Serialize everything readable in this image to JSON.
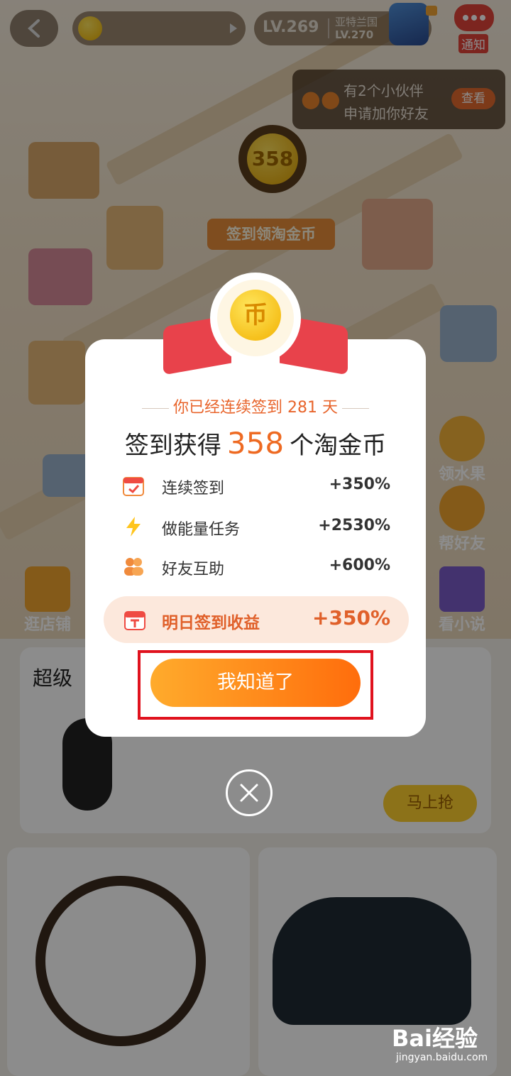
{
  "topbar": {
    "level_current": "LV.269",
    "next_place": "亚特兰国",
    "level_next": "LV.270",
    "notify_label": "通知"
  },
  "friend_tip": {
    "line1": "有2个小伙伴",
    "line2": "申请加你好友",
    "view_label": "查看"
  },
  "map": {
    "coin_value": "358",
    "sign_banner": "签到领淘金币",
    "side_buttons": [
      "领水果",
      "帮好友",
      "逛店铺",
      "看小说"
    ]
  },
  "background_cards": {
    "section_title": "超级",
    "grab_button": "马上抢"
  },
  "modal": {
    "medal_glyph": "币",
    "streak_text": "你已经连续签到 281 天",
    "gain_prefix": "签到获得",
    "gain_number": "358",
    "gain_suffix": "个淘金币",
    "rows": [
      {
        "icon": "calendar-check-icon",
        "label": "连续签到",
        "value": "+350%"
      },
      {
        "icon": "lightning-icon",
        "label": "做能量任务",
        "value": "+2530%"
      },
      {
        "icon": "friends-icon",
        "label": "好友互助",
        "value": "+600%"
      }
    ],
    "tomorrow": {
      "icon": "calendar-t-icon",
      "label": "明日签到收益",
      "value": "+350%"
    },
    "ok_button": "我知道了",
    "close_icon": "close-icon"
  },
  "watermark": {
    "brand": "Bai经验",
    "url": "jingyan.baidu.com"
  },
  "colors": {
    "accent": "#ee6a22",
    "button_start": "#ffab2c",
    "button_end": "#ff6d0c",
    "ribbon": "#e8424b",
    "highlight_box": "#e0121e"
  }
}
